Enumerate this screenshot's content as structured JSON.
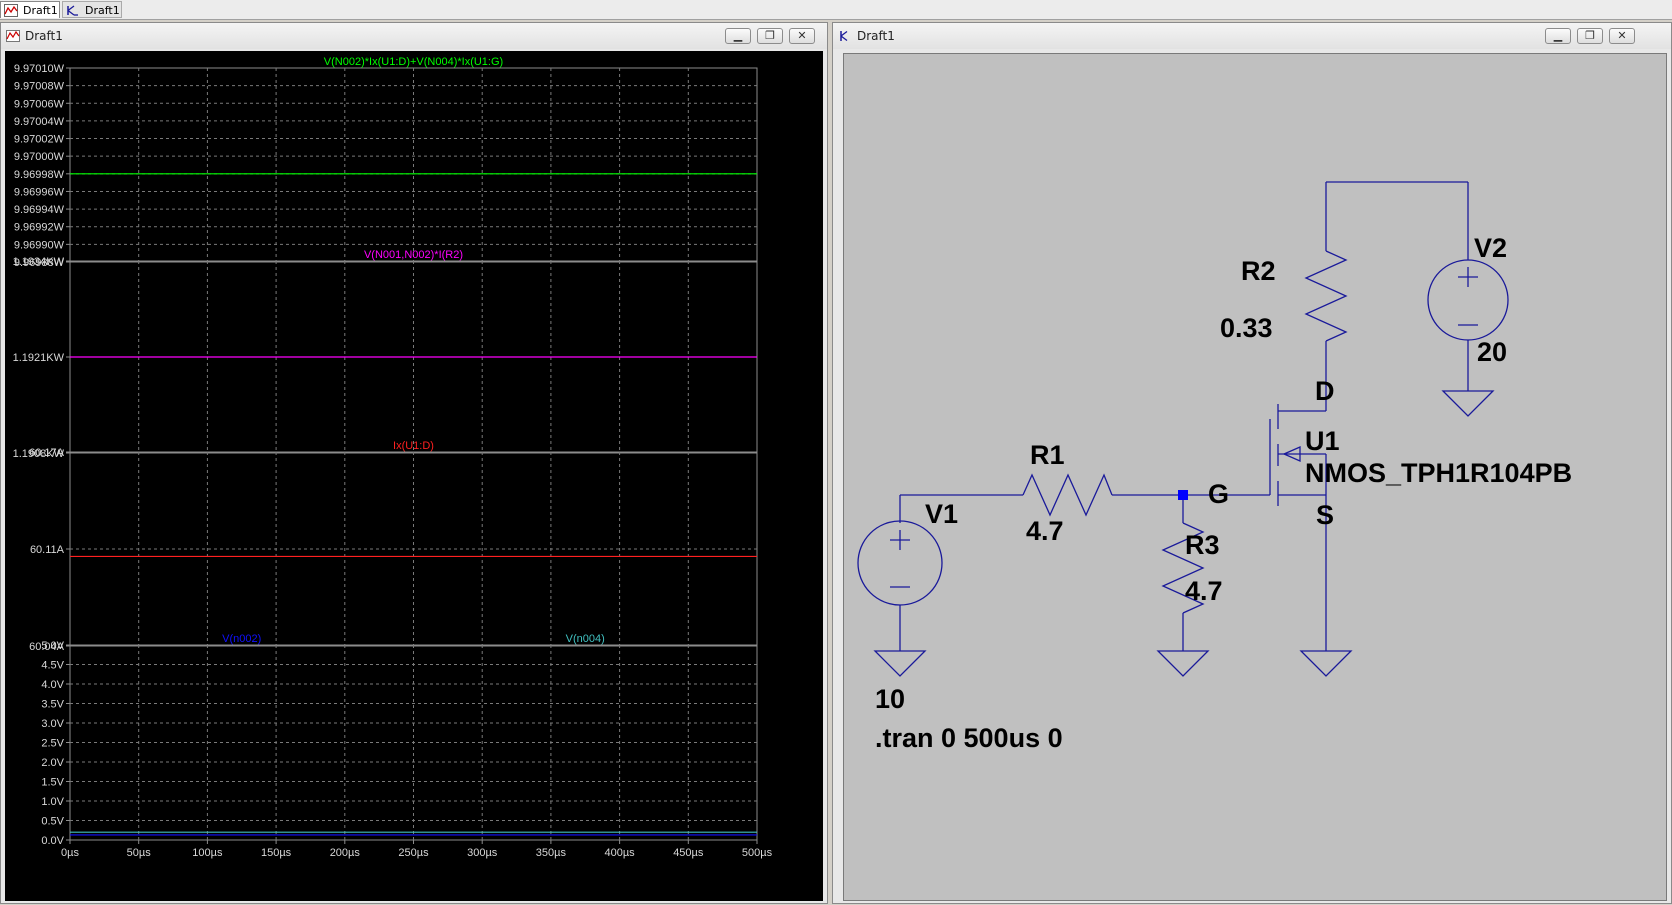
{
  "tabs": [
    {
      "label": "Draft1",
      "icon": "waveform-icon"
    },
    {
      "label": "Draft1",
      "icon": "schematic-icon"
    }
  ],
  "plot_window": {
    "title": "Draft1",
    "icon": "waveform-icon"
  },
  "schematic_window": {
    "title": "Draft1",
    "icon": "schematic-icon"
  },
  "window_controls": {
    "minimize": "▁",
    "restore": "❐",
    "close": "✕"
  },
  "colors": {
    "pane1_trace": "#00ff00",
    "pane2_trace": "#ff00ff",
    "pane3_trace": "#ff2020",
    "pane4_trace_a": "#1010ff",
    "pane4_trace_b": "#40c0c0",
    "wire": "#1a1a9a",
    "node": "#0000ff"
  },
  "chart_data": [
    {
      "type": "line",
      "title": "V(N002)*Ix(U1:D)+V(N004)*Ix(U1:G)",
      "ylim": [
        9.96988,
        9.9701
      ],
      "yticks": [
        "9.97010W",
        "9.97008W",
        "9.97006W",
        "9.97004W",
        "9.97002W",
        "9.97000W",
        "9.96998W",
        "9.96996W",
        "9.96994W",
        "9.96992W",
        "9.96990W",
        "9.96988W"
      ],
      "series": [
        {
          "name": "V(N002)*Ix(U1:D)+V(N004)*Ix(U1:G)",
          "x": [
            0,
            500
          ],
          "y": [
            9.96998,
            9.96998
          ]
        }
      ]
    },
    {
      "type": "line",
      "title": "V(N001,N002)*I(R2)",
      "ylim": [
        1190.8,
        1193.4
      ],
      "yticks": [
        "1.1934KW",
        "1.1921KW",
        "1.1908KW"
      ],
      "series": [
        {
          "name": "V(N001,N002)*I(R2)",
          "x": [
            0,
            500
          ],
          "y": [
            1192.1,
            1192.1
          ]
        }
      ]
    },
    {
      "type": "line",
      "title": "Ix(U1:D)",
      "ylim": [
        60.04,
        60.17
      ],
      "yticks": [
        "60.17A",
        "60.11A",
        "60.04A"
      ],
      "series": [
        {
          "name": "Ix(U1:D)",
          "x": [
            0,
            500
          ],
          "y": [
            60.1,
            60.1
          ]
        }
      ]
    },
    {
      "type": "line",
      "title": "",
      "ylim": [
        0,
        5
      ],
      "yticks": [
        "5.0V",
        "4.5V",
        "4.0V",
        "3.5V",
        "3.0V",
        "2.5V",
        "2.0V",
        "1.5V",
        "1.0V",
        "0.5V",
        "0.0V"
      ],
      "series": [
        {
          "name": "V(n002)",
          "x": [
            0,
            500
          ],
          "y": [
            0.13,
            0.13
          ]
        },
        {
          "name": "V(n004)",
          "x": [
            0,
            500
          ],
          "y": [
            0.2,
            0.2
          ]
        }
      ]
    }
  ],
  "xaxis": {
    "xlim": [
      0,
      500
    ],
    "ticks": [
      "0µs",
      "50µs",
      "100µs",
      "150µs",
      "200µs",
      "250µs",
      "300µs",
      "350µs",
      "400µs",
      "450µs",
      "500µs"
    ]
  },
  "schematic": {
    "V1": {
      "name": "V1",
      "value": "10"
    },
    "V2": {
      "name": "V2",
      "value": "20"
    },
    "R1": {
      "name": "R1",
      "value": "4.7"
    },
    "R2": {
      "name": "R2",
      "value": "0.33"
    },
    "R3": {
      "name": "R3",
      "value": "4.7"
    },
    "U1": {
      "name": "U1",
      "model": "NMOS_TPH1R104PB"
    },
    "pins": {
      "drain": "D",
      "gate": "G",
      "source": "S"
    },
    "directive": ".tran 0 500us 0"
  }
}
